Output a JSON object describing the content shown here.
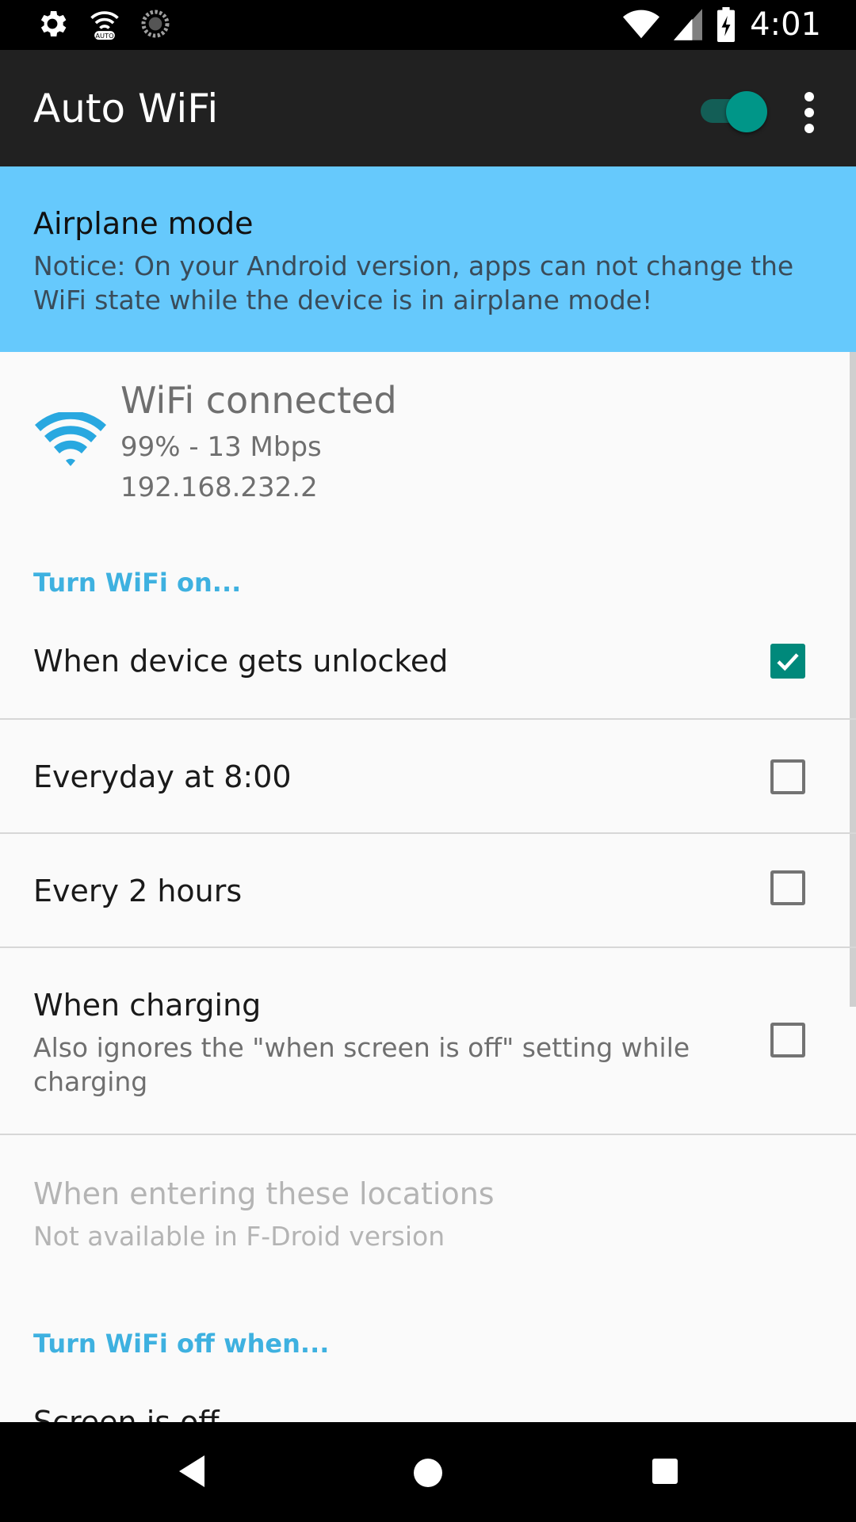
{
  "status_bar": {
    "time": "4:01",
    "left_icons": [
      "settings-icon",
      "wifi-auto-icon",
      "sync-icon"
    ],
    "right_icons": [
      "wifi-signal-icon",
      "cell-signal-icon",
      "battery-charging-icon"
    ]
  },
  "app_bar": {
    "title": "Auto WiFi",
    "master_switch_on": true,
    "accent": "#009688"
  },
  "notice": {
    "title": "Airplane mode",
    "text": "Notice: On your Android version, apps can not change the WiFi state while the device is in airplane mode!",
    "background": "#66c9fc"
  },
  "wifi_status": {
    "title": "WiFi connected",
    "signal": "99% - 13 Mbps",
    "ip": "192.168.232.2"
  },
  "turn_on": {
    "header": "Turn WiFi on...",
    "items": [
      {
        "label": "When device gets unlocked",
        "checked": true
      },
      {
        "label": "Everyday at 8:00",
        "checked": false
      },
      {
        "label": "Every 2 hours",
        "checked": false
      },
      {
        "label": "When charging",
        "summary": "Also ignores the \"when screen is off\" setting while charging",
        "checked": false
      }
    ],
    "locations": {
      "label": "When entering these locations",
      "summary": "Not available in F-Droid version"
    }
  },
  "turn_off": {
    "header": "Turn WiFi off when...",
    "first_item": "Screen is off"
  },
  "nav_bar": {
    "icons": [
      "back-icon",
      "home-icon",
      "recents-icon"
    ]
  }
}
